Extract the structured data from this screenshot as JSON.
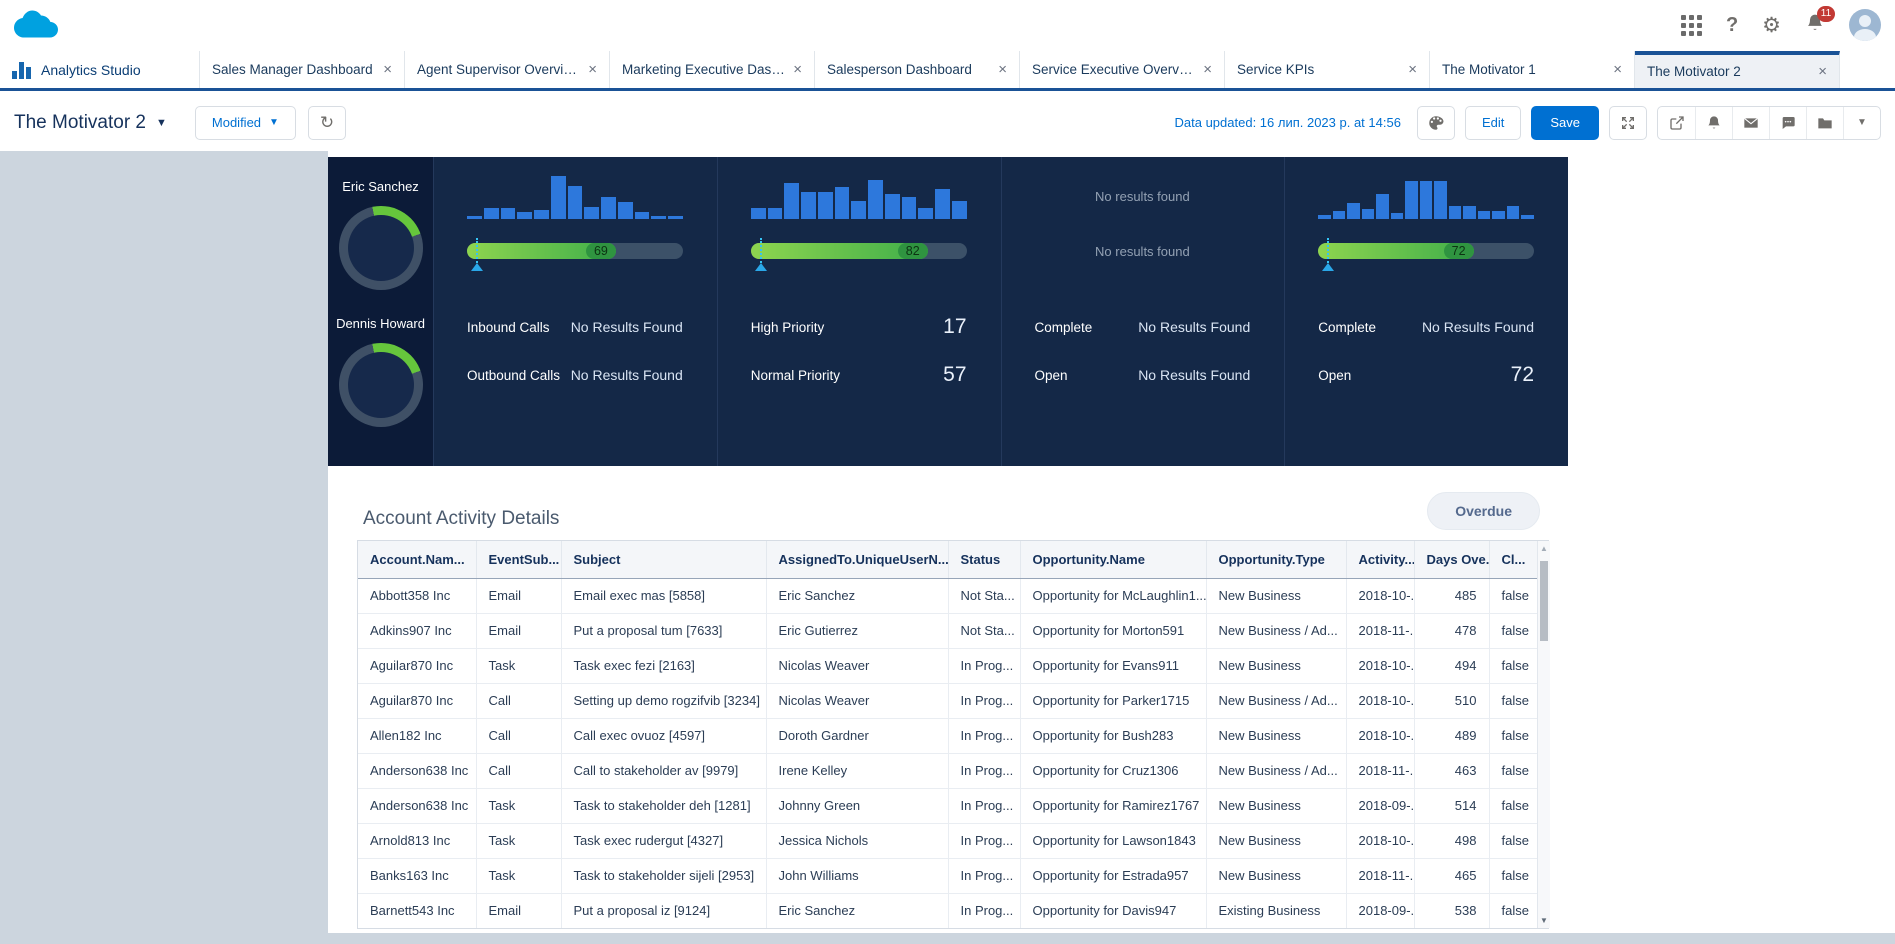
{
  "icons": {
    "close": "×",
    "caret_down": "▼",
    "gear": "⚙",
    "help": "?",
    "refresh": "↻",
    "scroll_up": "▲",
    "scroll_down": "▼"
  },
  "header": {
    "notifications_badge": "11"
  },
  "tabs": [
    {
      "label": "Analytics Studio",
      "home": true,
      "closable": false,
      "active": false
    },
    {
      "label": "Sales Manager Dashboard",
      "closable": true,
      "active": false
    },
    {
      "label": "Agent Supervisor Overview",
      "closable": true,
      "active": false
    },
    {
      "label": "Marketing Executive Dashb...",
      "closable": true,
      "active": false
    },
    {
      "label": "Salesperson Dashboard",
      "closable": true,
      "active": false
    },
    {
      "label": "Service Executive Overview",
      "closable": true,
      "active": false
    },
    {
      "label": "Service KPIs",
      "closable": true,
      "active": false
    },
    {
      "label": "The Motivator 1",
      "closable": true,
      "active": false
    },
    {
      "label": "The Motivator 2",
      "closable": true,
      "active": true
    }
  ],
  "toolbar": {
    "title": "The Motivator 2",
    "state_button": "Modified",
    "data_updated": "Data updated: 16 лип. 2023 р. at 14:56",
    "edit_label": "Edit",
    "save_label": "Save"
  },
  "dashboard": {
    "people": [
      {
        "name": "Eric Sanchez"
      },
      {
        "name": "Dennis Howard"
      }
    ],
    "columns": [
      {
        "histogram": [
          3,
          11,
          11,
          7,
          9,
          43,
          33,
          12,
          22,
          17,
          7,
          3,
          3
        ],
        "gauge": 69,
        "metrics": [
          {
            "label": "Inbound Calls",
            "value": "No Results Found"
          },
          {
            "label": "Outbound Calls",
            "value": "No Results Found"
          }
        ]
      },
      {
        "histogram": [
          11,
          11,
          36,
          27,
          27,
          32,
          18,
          39,
          25,
          22,
          11,
          30,
          18
        ],
        "gauge": 82,
        "metrics": [
          {
            "label": "High Priority",
            "value": "17"
          },
          {
            "label": "Normal Priority",
            "value": "57"
          }
        ]
      },
      {
        "empty": [
          "No results found",
          "No results found"
        ],
        "metrics": [
          {
            "label": "Complete",
            "value": "No Results Found"
          },
          {
            "label": "Open",
            "value": "No Results Found"
          }
        ]
      },
      {
        "histogram": [
          4,
          8,
          16,
          10,
          25,
          6,
          38,
          38,
          38,
          13,
          13,
          8,
          8,
          13,
          4
        ],
        "gauge": 72,
        "metrics": [
          {
            "label": "Complete",
            "value": "No Results Found"
          },
          {
            "label": "Open",
            "value": "72"
          }
        ]
      }
    ]
  },
  "table": {
    "title": "Account Activity Details",
    "filter_button": "Overdue",
    "columns": [
      "Account.Nam...",
      "EventSub...",
      "Subject",
      "AssignedTo.UniqueUserN...",
      "Status",
      "Opportunity.Name",
      "Opportunity.Type",
      "Activity...",
      "Days Ove...",
      "Cl..."
    ],
    "column_keys": [
      "account-name",
      "event-subtype",
      "subject",
      "assigned-to",
      "status",
      "opportunity-name",
      "opportunity-type",
      "activity-date",
      "days-overdue",
      "closed"
    ],
    "rows": [
      [
        "Abbott358 Inc",
        "Email",
        "Email exec mas [5858]",
        "Eric Sanchez",
        "Not Sta...",
        "Opportunity for McLaughlin1...",
        "New Business",
        "2018-10-...",
        "485",
        "false"
      ],
      [
        "Adkins907 Inc",
        "Email",
        "Put a proposal tum [7633]",
        "Eric Gutierrez",
        "Not Sta...",
        "Opportunity for Morton591",
        "New Business / Ad...",
        "2018-11-...",
        "478",
        "false"
      ],
      [
        "Aguilar870 Inc",
        "Task",
        "Task exec fezi [2163]",
        "Nicolas Weaver",
        "In Prog...",
        "Opportunity for Evans911",
        "New Business",
        "2018-10-...",
        "494",
        "false"
      ],
      [
        "Aguilar870 Inc",
        "Call",
        "Setting up demo rogzifvib [3234]",
        "Nicolas Weaver",
        "In Prog...",
        "Opportunity for Parker1715",
        "New Business / Ad...",
        "2018-10-...",
        "510",
        "false"
      ],
      [
        "Allen182 Inc",
        "Call",
        "Call exec ovuoz [4597]",
        "Doroth Gardner",
        "In Prog...",
        "Opportunity for Bush283",
        "New Business",
        "2018-10-...",
        "489",
        "false"
      ],
      [
        "Anderson638 Inc",
        "Call",
        "Call to stakeholder av [9979]",
        "Irene Kelley",
        "In Prog...",
        "Opportunity for Cruz1306",
        "New Business / Ad...",
        "2018-11-...",
        "463",
        "false"
      ],
      [
        "Anderson638 Inc",
        "Task",
        "Task to stakeholder deh [1281]",
        "Johnny Green",
        "In Prog...",
        "Opportunity for Ramirez1767",
        "New Business",
        "2018-09-...",
        "514",
        "false"
      ],
      [
        "Arnold813 Inc",
        "Task",
        "Task exec rudergut [4327]",
        "Jessica Nichols",
        "In Prog...",
        "Opportunity for Lawson1843",
        "New Business",
        "2018-10-...",
        "498",
        "false"
      ],
      [
        "Banks163 Inc",
        "Task",
        "Task to stakeholder sijeli [2953]",
        "John Williams",
        "In Prog...",
        "Opportunity for Estrada957",
        "New Business",
        "2018-11-...",
        "465",
        "false"
      ],
      [
        "Barnett543 Inc",
        "Email",
        "Put a proposal iz [9124]",
        "Eric Sanchez",
        "In Prog...",
        "Opportunity for Davis947",
        "Existing Business",
        "2018-09-...",
        "538",
        "false"
      ]
    ]
  }
}
